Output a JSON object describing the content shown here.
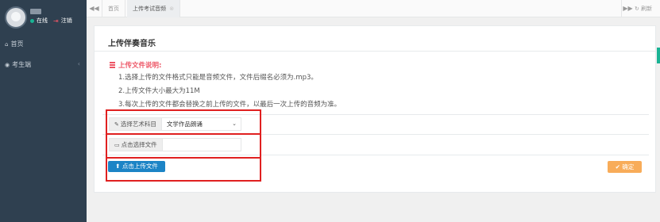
{
  "sidebar": {
    "status_online": "在线",
    "logout": "注销",
    "items": [
      {
        "label": "首页",
        "icon": "home-icon"
      },
      {
        "label": "考生端",
        "icon": "user-circle-icon"
      }
    ]
  },
  "topbar": {
    "tabs": [
      {
        "label": "首页"
      },
      {
        "label": "上传考试音频",
        "close": "⊗"
      }
    ],
    "refresh": "刷新"
  },
  "panel": {
    "title": "上传伴奏音乐",
    "notes_title": "上传文件说明:",
    "notes": [
      "1.选择上传的文件格式只能是音频文件，文件后缀名必须为.mp3。",
      "2.上传文件大小最大为11M",
      "3.每次上传的文件都会替换之前上传的文件，以最后一次上传的音频为准。"
    ],
    "subject_label": "选择艺术科目",
    "subject_value": "文学作品朗诵",
    "file_label": "点击选择文件",
    "file_value": "",
    "upload_button": "点击上传文件",
    "confirm_button": "确定"
  },
  "colors": {
    "sidebar_bg": "#2f4050",
    "online": "#1ab394",
    "danger": "#ed5565",
    "primary_button": "#1c84c6",
    "warning_button": "#f8ac59",
    "annotation_box": "#e02020"
  }
}
